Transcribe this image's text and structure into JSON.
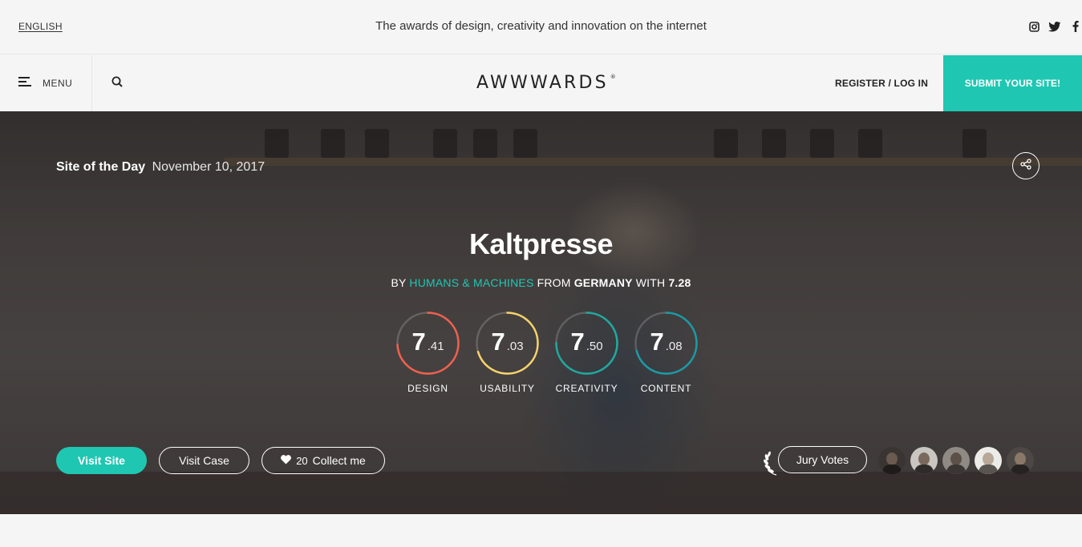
{
  "topbar": {
    "language": "ENGLISH",
    "tagline": "The awards of design, creativity and innovation on the internet",
    "socials": [
      "instagram-icon",
      "twitter-icon",
      "facebook-icon"
    ]
  },
  "nav": {
    "menu_label": "MENU",
    "logo": "AWWWARDS",
    "logo_mark": "®",
    "login": "REGISTER / LOG IN",
    "submit": "SUBMIT YOUR SITE!"
  },
  "hero": {
    "award": "Site of the Day",
    "date": "November 10, 2017",
    "title": "Kaltpresse",
    "by_prefix": "BY",
    "agency": "HUMANS & MACHINES",
    "from_prefix": "FROM",
    "country": "GERMANY",
    "with_prefix": "WITH",
    "score": "7.28",
    "scores": [
      {
        "label": "DESIGN",
        "int": "7",
        "dec": ".41",
        "value": 7.41,
        "color": "#f0604d"
      },
      {
        "label": "USABILITY",
        "int": "7",
        "dec": ".03",
        "value": 7.03,
        "color": "#f5d36b"
      },
      {
        "label": "CREATIVITY",
        "int": "7",
        "dec": ".50",
        "value": 7.5,
        "color": "#1fa9a0"
      },
      {
        "label": "CONTENT",
        "int": "7",
        "dec": ".08",
        "value": 7.08,
        "color": "#1b9aa5"
      }
    ],
    "buttons": {
      "visit_site": "Visit Site",
      "visit_case": "Visit Case",
      "collect_count": "20",
      "collect_label": "Collect me",
      "jury": "Jury Votes"
    }
  },
  "colors": {
    "accent": "#1fc7b2"
  }
}
